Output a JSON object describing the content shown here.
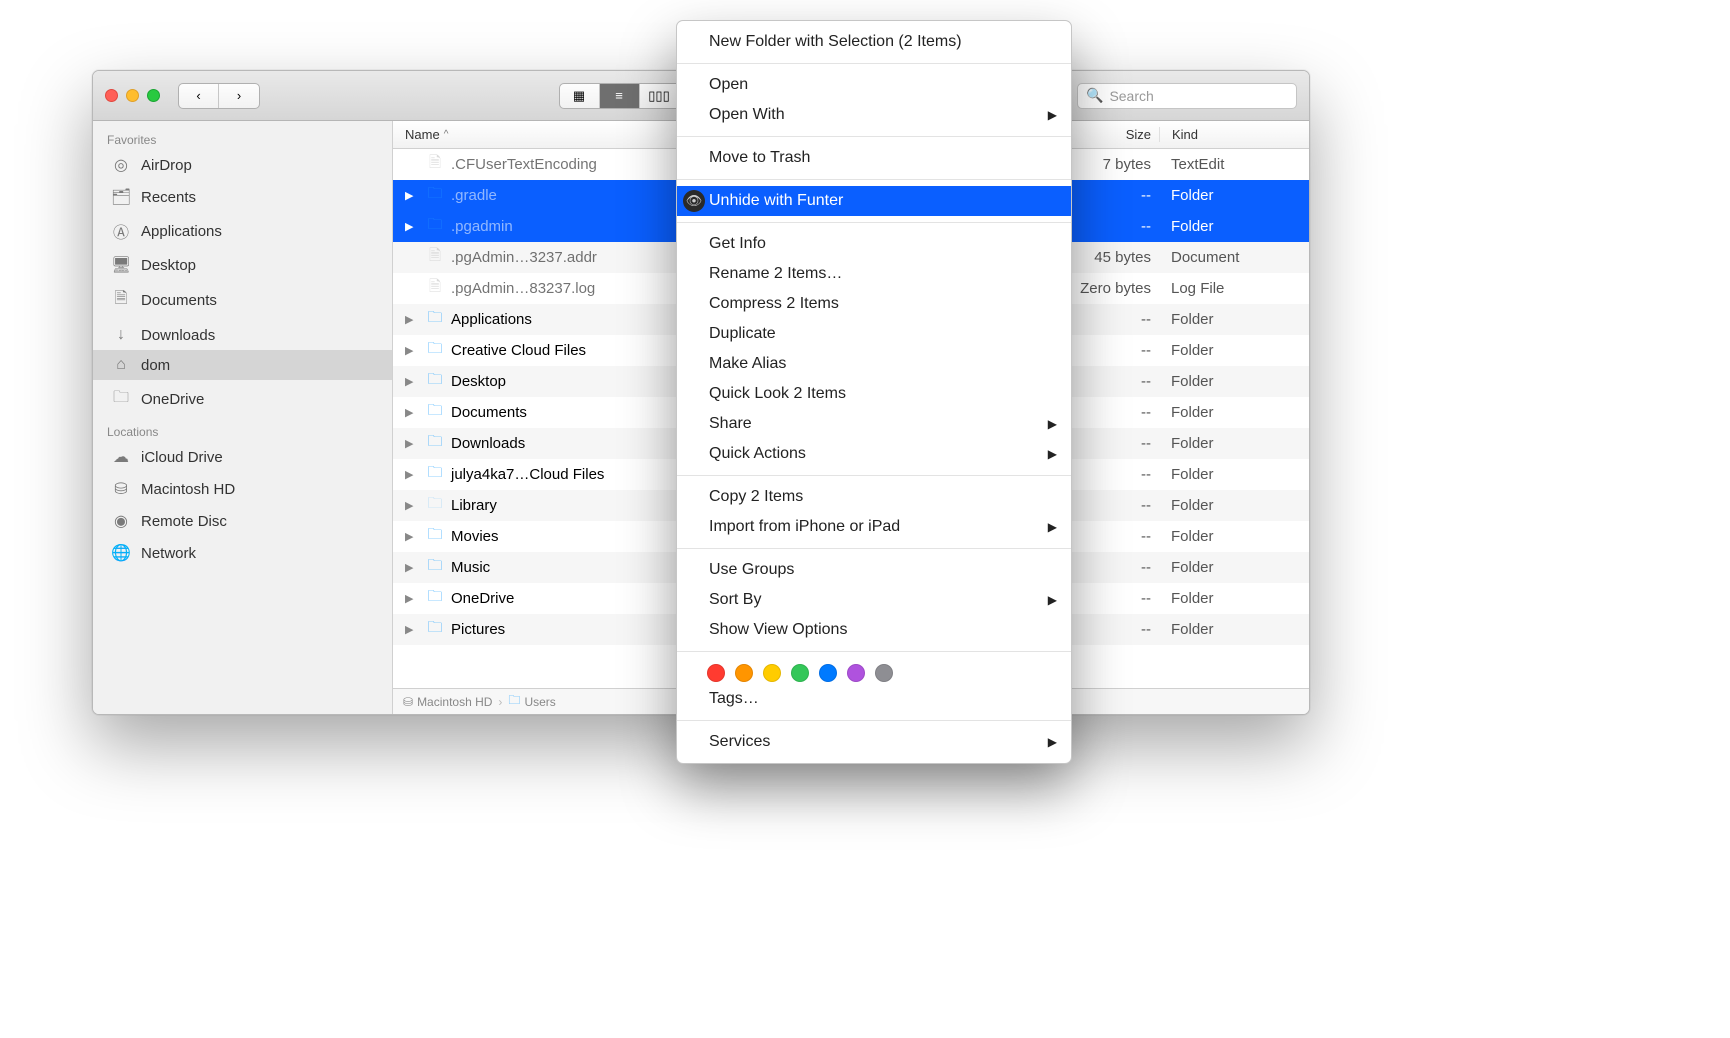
{
  "window": {
    "search_placeholder": "Search"
  },
  "sidebar": {
    "favorites_header": "Favorites",
    "locations_header": "Locations",
    "favorites": [
      {
        "label": "AirDrop",
        "icon": "◎"
      },
      {
        "label": "Recents",
        "icon": "🗂"
      },
      {
        "label": "Applications",
        "icon": "Ⓐ"
      },
      {
        "label": "Desktop",
        "icon": "🖥"
      },
      {
        "label": "Documents",
        "icon": "🗎"
      },
      {
        "label": "Downloads",
        "icon": "↓"
      },
      {
        "label": "dom",
        "icon": "⌂",
        "selected": true
      },
      {
        "label": "OneDrive",
        "icon": "🗀"
      }
    ],
    "locations": [
      {
        "label": "iCloud Drive",
        "icon": "☁"
      },
      {
        "label": "Macintosh HD",
        "icon": "⛁"
      },
      {
        "label": "Remote Disc",
        "icon": "◉"
      },
      {
        "label": "Network",
        "icon": "🌐"
      }
    ]
  },
  "columns": {
    "name": "Name",
    "size": "Size",
    "kind": "Kind",
    "sort_indicator": "^"
  },
  "files": [
    {
      "name": ".CFUserTextEncoding",
      "icon": "file",
      "size": "7 bytes",
      "kind": "TextEdit",
      "hidden": true,
      "folder": false
    },
    {
      "name": ".gradle",
      "icon": "folder",
      "size": "--",
      "kind": "Folder",
      "hidden": true,
      "folder": true,
      "selected": true
    },
    {
      "name": ".pgadmin",
      "icon": "folder",
      "size": "--",
      "kind": "Folder",
      "hidden": true,
      "folder": true,
      "selected": true
    },
    {
      "name": ".pgAdmin…3237.addr",
      "icon": "file",
      "size": "45 bytes",
      "kind": "Document",
      "hidden": true,
      "folder": false
    },
    {
      "name": ".pgAdmin…83237.log",
      "icon": "file",
      "size": "Zero bytes",
      "kind": "Log File",
      "hidden": true,
      "folder": false
    },
    {
      "name": "Applications",
      "icon": "folder",
      "size": "--",
      "kind": "Folder",
      "folder": true
    },
    {
      "name": "Creative Cloud Files",
      "icon": "folder",
      "size": "--",
      "kind": "Folder",
      "folder": true
    },
    {
      "name": "Desktop",
      "icon": "folder",
      "size": "--",
      "kind": "Folder",
      "folder": true
    },
    {
      "name": "Documents",
      "icon": "folder",
      "size": "--",
      "kind": "Folder",
      "folder": true
    },
    {
      "name": "Downloads",
      "icon": "folder",
      "size": "--",
      "kind": "Folder",
      "folder": true
    },
    {
      "name": "julya4ka7…Cloud Files",
      "icon": "folder",
      "size": "--",
      "kind": "Folder",
      "folder": true
    },
    {
      "name": "Library",
      "icon": "folder",
      "size": "--",
      "kind": "Folder",
      "folder": true,
      "dim": true
    },
    {
      "name": "Movies",
      "icon": "folder",
      "size": "--",
      "kind": "Folder",
      "folder": true
    },
    {
      "name": "Music",
      "icon": "folder",
      "size": "--",
      "kind": "Folder",
      "folder": true
    },
    {
      "name": "OneDrive",
      "icon": "folder",
      "size": "--",
      "kind": "Folder",
      "folder": true
    },
    {
      "name": "Pictures",
      "icon": "folder",
      "size": "--",
      "kind": "Folder",
      "folder": true
    }
  ],
  "pathbar": {
    "disk": "Macintosh HD",
    "segment": "Users"
  },
  "context_menu": {
    "items": [
      {
        "type": "item",
        "label": "New Folder with Selection (2 Items)"
      },
      {
        "type": "sep"
      },
      {
        "type": "item",
        "label": "Open"
      },
      {
        "type": "item",
        "label": "Open With",
        "submenu": true
      },
      {
        "type": "sep"
      },
      {
        "type": "item",
        "label": "Move to Trash"
      },
      {
        "type": "sep"
      },
      {
        "type": "item",
        "label": "Unhide with Funter",
        "highlight": true,
        "funter": true
      },
      {
        "type": "sep"
      },
      {
        "type": "item",
        "label": "Get Info"
      },
      {
        "type": "item",
        "label": "Rename 2 Items…"
      },
      {
        "type": "item",
        "label": "Compress 2 Items"
      },
      {
        "type": "item",
        "label": "Duplicate"
      },
      {
        "type": "item",
        "label": "Make Alias"
      },
      {
        "type": "item",
        "label": "Quick Look 2 Items"
      },
      {
        "type": "item",
        "label": "Share",
        "submenu": true
      },
      {
        "type": "item",
        "label": "Quick Actions",
        "submenu": true
      },
      {
        "type": "sep"
      },
      {
        "type": "item",
        "label": "Copy 2 Items"
      },
      {
        "type": "item",
        "label": "Import from iPhone or iPad",
        "submenu": true
      },
      {
        "type": "sep"
      },
      {
        "type": "item",
        "label": "Use Groups"
      },
      {
        "type": "item",
        "label": "Sort By",
        "submenu": true
      },
      {
        "type": "item",
        "label": "Show View Options"
      },
      {
        "type": "sep"
      },
      {
        "type": "tags"
      },
      {
        "type": "item",
        "label": "Tags…"
      },
      {
        "type": "sep"
      },
      {
        "type": "item",
        "label": "Services",
        "submenu": true
      }
    ],
    "tag_colors": [
      "#ff3b30",
      "#ff9500",
      "#ffcc00",
      "#34c759",
      "#007aff",
      "#af52de",
      "#8e8e93"
    ]
  }
}
